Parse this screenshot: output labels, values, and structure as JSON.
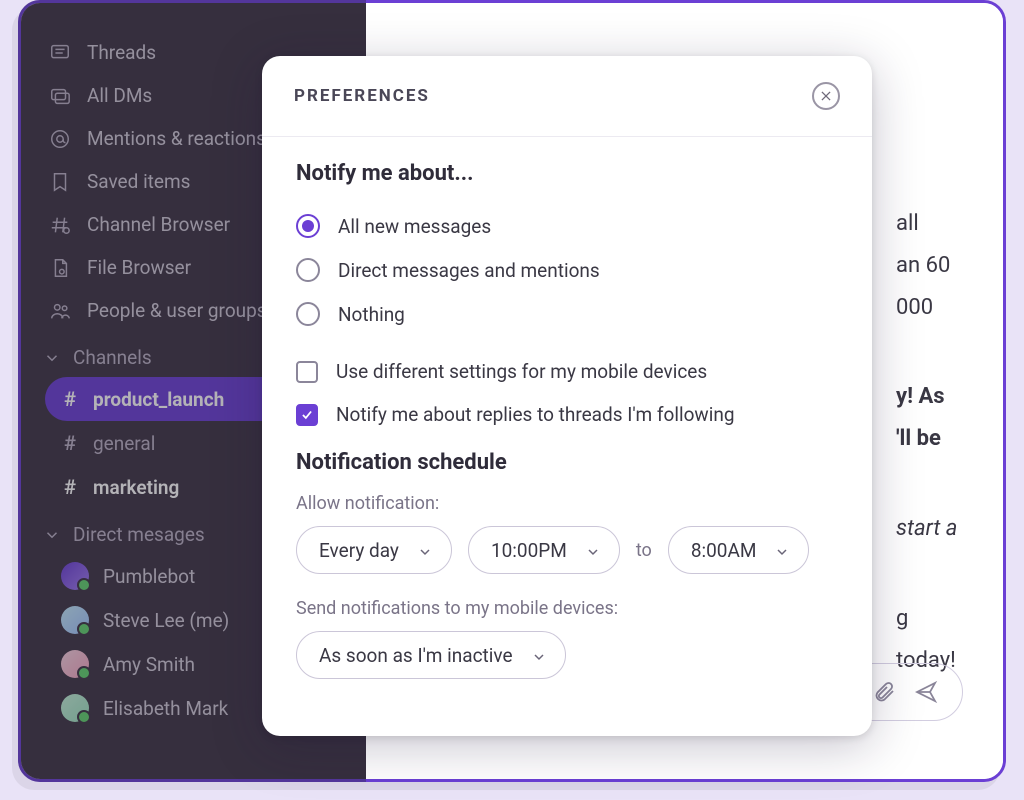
{
  "sidebar": {
    "nav": [
      {
        "icon": "threads",
        "label": "Threads"
      },
      {
        "icon": "dms",
        "label": "All DMs"
      },
      {
        "icon": "mentions",
        "label": "Mentions & reactions"
      },
      {
        "icon": "bookmark",
        "label": "Saved items"
      },
      {
        "icon": "channel-browser",
        "label": "Channel Browser"
      },
      {
        "icon": "file-browser",
        "label": "File Browser"
      },
      {
        "icon": "people",
        "label": "People & user groups"
      }
    ],
    "channels_header": "Channels",
    "channels": [
      {
        "name": "product_launch",
        "active": true,
        "bold": true
      },
      {
        "name": "general",
        "active": false,
        "bold": false
      },
      {
        "name": "marketing",
        "active": false,
        "bold": true
      }
    ],
    "dms_header": "Direct mesages",
    "dms": [
      {
        "name": "Pumblebot"
      },
      {
        "name": "Steve Lee (me)"
      },
      {
        "name": "Amy Smith"
      },
      {
        "name": "Elisabeth Mark"
      }
    ]
  },
  "main": {
    "message_fragments": [
      "all",
      "an 60 000",
      "y! As",
      "'ll be",
      "start a",
      "g today!"
    ]
  },
  "modal": {
    "title": "PREFERENCES",
    "notify_header": "Notify me about...",
    "radios": {
      "all": "All new messages",
      "dm": "Direct messages and mentions",
      "nothing": "Nothing"
    },
    "checkboxes": {
      "mobile_diff": "Use different settings for my mobile devices",
      "thread_replies": "Notify me about replies to threads I'm following"
    },
    "schedule_header": "Notification schedule",
    "allow_label": "Allow notification:",
    "pills": {
      "frequency": "Every day",
      "start": "10:00PM",
      "to": "to",
      "end": "8:00AM"
    },
    "mobile_label": "Send notifications to my mobile devices:",
    "mobile_value": "As soon as I'm inactive"
  },
  "colors": {
    "accent": "#6b3fd4"
  }
}
